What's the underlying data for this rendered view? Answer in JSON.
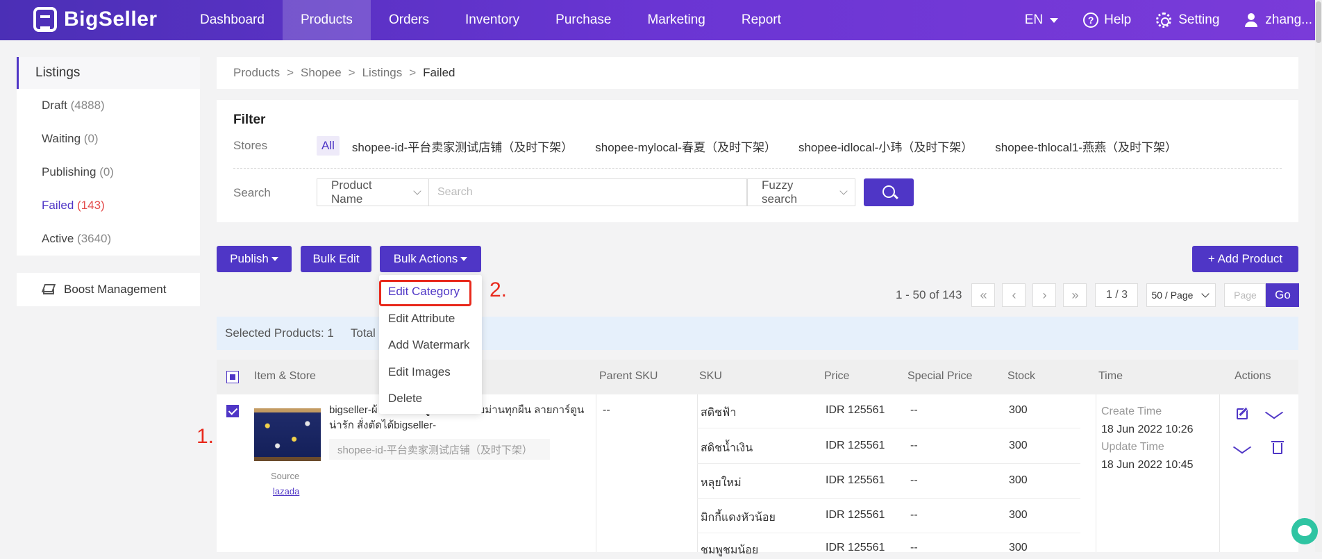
{
  "brand": {
    "name": "BigSeller"
  },
  "nav": {
    "items": [
      "Dashboard",
      "Products",
      "Orders",
      "Inventory",
      "Purchase",
      "Marketing",
      "Report"
    ],
    "active": "Products"
  },
  "topright": {
    "lang": "EN",
    "help": "Help",
    "setting": "Setting",
    "user": "zhang..."
  },
  "sidebar": {
    "title": "Listings",
    "items": [
      {
        "label": "Draft",
        "count": "(4888)"
      },
      {
        "label": "Waiting",
        "count": "(0)"
      },
      {
        "label": "Publishing",
        "count": "(0)"
      },
      {
        "label": "Failed",
        "count": "(143)"
      },
      {
        "label": "Active",
        "count": "(3640)"
      }
    ],
    "boost": "Boost Management"
  },
  "breadcrumb": {
    "items": [
      "Products",
      "Shopee",
      "Listings"
    ],
    "current": "Failed"
  },
  "filter": {
    "title": "Filter",
    "stores_label": "Stores",
    "stores": [
      "All",
      "shopee-id-平台卖家测试店铺（及时下架）",
      "shopee-mylocal-春夏（及时下架）",
      "shopee-idlocal-小玮（及时下架）",
      "shopee-thlocal1-燕燕（及时下架）"
    ],
    "search_label": "Search",
    "search_field": "Product Name",
    "search_placeholder": "Search",
    "search_mode": "Fuzzy search"
  },
  "actions": {
    "publish": "Publish",
    "bulk_edit": "Bulk Edit",
    "bulk_actions": "Bulk Actions",
    "add_product": "+ Add Product"
  },
  "bulk_menu": [
    "Edit Category",
    "Edit Attribute",
    "Add Watermark",
    "Edit Images",
    "Delete"
  ],
  "pager": {
    "range": "1 - 50 of 143",
    "page": "1 / 3",
    "size": "50 / Page",
    "page_placeholder": "Page",
    "go": "Go"
  },
  "selection": {
    "selected": "Selected Products: 1",
    "total_prefix": "Total P"
  },
  "table": {
    "headers": [
      "Item & Store",
      "Parent SKU",
      "SKU",
      "Price",
      "Special Price",
      "Stock",
      "Time",
      "Actions"
    ],
    "row": {
      "title": "bigseller-ผ้ ... กว้าง3 สูง 2 แถมสายม่านทุกผืน ลายการ์ตูนน่ารัก สั่งตัดได้bigseller-",
      "store": "shopee-id-平台卖家测试店铺（及时下架）",
      "source_label": "Source",
      "source": "lazada",
      "parent_sku": "--",
      "variants": [
        {
          "sku": "สดิชฟ้า",
          "price": "IDR 125561",
          "special": "--",
          "stock": "300"
        },
        {
          "sku": "สดิชน้ำเงิน",
          "price": "IDR 125561",
          "special": "--",
          "stock": "300"
        },
        {
          "sku": "หลุยใหม่",
          "price": "IDR 125561",
          "special": "--",
          "stock": "300"
        },
        {
          "sku": "มิกกี้แดงหัวน้อย",
          "price": "IDR 125561",
          "special": "--",
          "stock": "300"
        },
        {
          "sku": "ชมพูชมน้อย",
          "price": "IDR 125561",
          "special": "--",
          "stock": "300"
        }
      ],
      "create_label": "Create Time",
      "create_time": "18 Jun 2022 10:26",
      "update_label": "Update Time",
      "update_time": "18 Jun 2022 10:45"
    }
  },
  "annotations": {
    "step1": "1.",
    "step2": "2."
  },
  "colors": {
    "primary": "#4f36c6",
    "highlight": "#e8291c"
  }
}
